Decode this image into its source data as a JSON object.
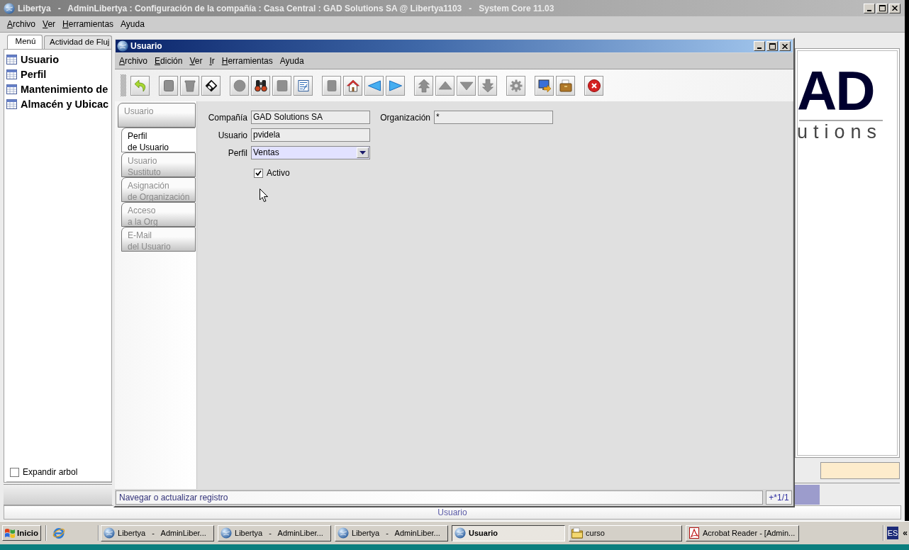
{
  "main_window": {
    "title": "Libertya   -   AdminLibertya : Configuración de la compañía : Casa Central : GAD Solutions SA @ Libertya1103   -   System Core 11.03",
    "menu": [
      {
        "label": "Archivo",
        "mnemonic": true
      },
      {
        "label": "Ver",
        "mnemonic": true
      },
      {
        "label": "Herramientas",
        "mnemonic": true
      },
      {
        "label": "Ayuda",
        "mnemonic": false
      }
    ],
    "tabs": [
      {
        "label": "Menú",
        "selected": true
      },
      {
        "label": "Actividad de Fluj",
        "selected": false
      }
    ],
    "tree": {
      "items": [
        {
          "label": "Usuario"
        },
        {
          "label": "Perfil"
        },
        {
          "label": "Mantenimiento de"
        },
        {
          "label": "Almacén y Ubicac"
        }
      ],
      "expand": {
        "label": "Expandir arbol",
        "checked": false
      }
    },
    "logo": {
      "mark": "AD",
      "tagline": "utions"
    },
    "status_bar": {
      "text": "Usuario"
    }
  },
  "inner_window": {
    "title": "Usuario",
    "menu": [
      {
        "label": "Archivo",
        "mnemonic": true
      },
      {
        "label": "Edición",
        "mnemonic": true
      },
      {
        "label": "Ver",
        "mnemonic": true
      },
      {
        "label": "Ir",
        "mnemonic": true
      },
      {
        "label": "Herramientas",
        "mnemonic": true
      },
      {
        "label": "Ayuda",
        "mnemonic": false
      }
    ],
    "toolbar": [
      [
        {
          "kind": "undo",
          "disabled": false
        }
      ],
      [
        {
          "kind": "new",
          "disabled": true
        },
        {
          "kind": "delete",
          "disabled": true
        },
        {
          "kind": "save",
          "disabled": false
        }
      ],
      [
        {
          "kind": "refresh",
          "disabled": true
        },
        {
          "kind": "find",
          "disabled": false
        },
        {
          "kind": "attachment",
          "disabled": true
        },
        {
          "kind": "grid",
          "disabled": false
        }
      ],
      [
        {
          "kind": "history",
          "disabled": true
        },
        {
          "kind": "home",
          "disabled": false
        },
        {
          "kind": "parent",
          "disabled": false
        },
        {
          "kind": "detail",
          "disabled": false
        }
      ],
      [
        {
          "kind": "first",
          "disabled": true
        },
        {
          "kind": "previous",
          "disabled": true
        },
        {
          "kind": "next",
          "disabled": true
        },
        {
          "kind": "last",
          "disabled": true
        }
      ],
      [
        {
          "kind": "workflow",
          "disabled": true
        }
      ],
      [
        {
          "kind": "report",
          "disabled": false
        },
        {
          "kind": "archive",
          "disabled": false
        }
      ],
      [
        {
          "kind": "exit",
          "disabled": false
        }
      ]
    ],
    "tabs": [
      {
        "lines": [
          "Usuario"
        ],
        "selected": false,
        "children": [
          {
            "lines": [
              "Perfil",
              "de Usuario"
            ],
            "selected": true
          },
          {
            "lines": [
              "Usuario",
              "Sustituto"
            ],
            "selected": false
          },
          {
            "lines": [
              "Asignación",
              "de Organización"
            ],
            "selected": false
          },
          {
            "lines": [
              "Acceso",
              "a la Org"
            ],
            "selected": false
          },
          {
            "lines": [
              "E-Mail",
              "del Usuario"
            ],
            "selected": false
          }
        ]
      }
    ],
    "form": {
      "rows": [
        [
          {
            "kind": "text",
            "label": "Compañía",
            "value": "GAD Solutions SA",
            "readonly": true
          },
          {
            "kind": "text",
            "label": "Organización",
            "value": "*",
            "readonly": true
          }
        ],
        [
          {
            "kind": "text",
            "label": "Usuario",
            "value": "pvidela",
            "readonly": true
          }
        ],
        [
          {
            "kind": "combo",
            "label": "Perfil",
            "value": "Ventas",
            "readonly": false
          }
        ],
        [
          {
            "kind": "checkbox",
            "label": "Activo",
            "checked": true
          }
        ]
      ]
    },
    "status_bar": {
      "message": "Navegar o actualizar registro",
      "record": "+*1/1"
    }
  },
  "taskbar": {
    "start": {
      "label": "Inicio"
    },
    "tasks": [
      {
        "kind": "app",
        "label": "Libertya   -   AdminLiber...",
        "selected": false
      },
      {
        "kind": "app",
        "label": "Libertya   -   AdminLiber...",
        "selected": false
      },
      {
        "kind": "app",
        "label": "Libertya   -   AdminLiber...",
        "selected": false
      },
      {
        "kind": "app",
        "label": "Usuario",
        "selected": true
      },
      {
        "kind": "folder",
        "label": "curso",
        "selected": false
      },
      {
        "kind": "pdf",
        "label": "Acrobat Reader - [Admin...",
        "selected": false
      }
    ],
    "tray": {
      "language": "ES",
      "expand": "«"
    }
  }
}
